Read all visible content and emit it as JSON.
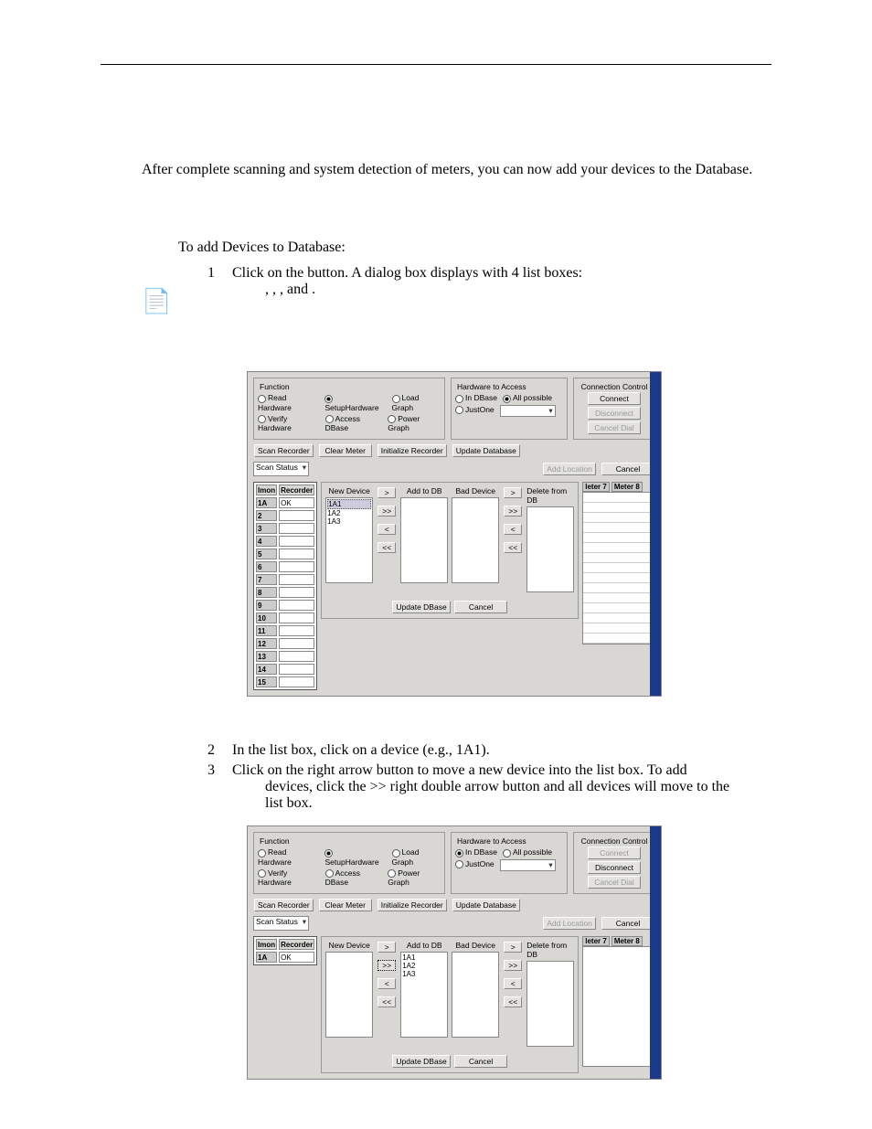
{
  "intro": "After complete scanning and system detection of meters, you can now add your devices to the Database.",
  "procedure_heading": "To add Devices to Database:",
  "steps": [
    {
      "num": "1",
      "a": "Click on the ",
      "b": " button.  A dialog box displays with 4 list boxes:",
      "c": ", ",
      "d": ", ",
      "e": ", and ",
      "f": "."
    },
    {
      "num": "2",
      "text": "In the                       list box, click on a device (e.g., 1A1)."
    },
    {
      "num": "3",
      "a": "Click on the    right arrow button to move a new device into the ",
      "b": "                list box. To add",
      "c": "devices, click the >> right double arrow button and all devices will move to the",
      "d": "list box."
    }
  ],
  "ui": {
    "function": {
      "title": "Function",
      "r1": "Read Hardware",
      "r2": "SetupHardware",
      "r3": "Load Graph",
      "r4": "Verify Hardware",
      "r5": "Access DBase",
      "r6": "Power Graph"
    },
    "hw": {
      "title": "Hardware to Access",
      "r1": "In DBase",
      "r2": "All possible",
      "r3": "JustOne"
    },
    "cc": {
      "title": "Connection Control",
      "connect": "Connect",
      "disconnect": "Disconnect",
      "cancel_dial": "Cancel Dial"
    },
    "btns": {
      "scan_recorder": "Scan Recorder",
      "clear_meter": "Clear Meter",
      "init_recorder": "Initialize Recorder",
      "update_database": "Update Database",
      "scan_status": "Scan Status",
      "add_location": "Add Location",
      "cancel": "Cancel",
      "update_dbase": "Update DBase"
    },
    "grid": {
      "col1": "Imon",
      "col2": "Recorder",
      "ok": "OK",
      "rows": [
        "1A",
        "2",
        "3",
        "4",
        "5",
        "6",
        "7",
        "8",
        "9",
        "10",
        "11",
        "12",
        "13",
        "14",
        "15"
      ]
    },
    "lists": {
      "new_device": "New Device",
      "add_to_db": "Add to DB",
      "bad_device": "Bad Device",
      "delete_from_db": "Delete from DB"
    },
    "devices": [
      "1A1",
      "1A2",
      "1A3"
    ],
    "arrows": {
      "r": ">",
      "rr": ">>",
      "l": "<",
      "ll": "<<"
    },
    "right_cols": [
      "leter 7",
      "Meter 8"
    ]
  }
}
